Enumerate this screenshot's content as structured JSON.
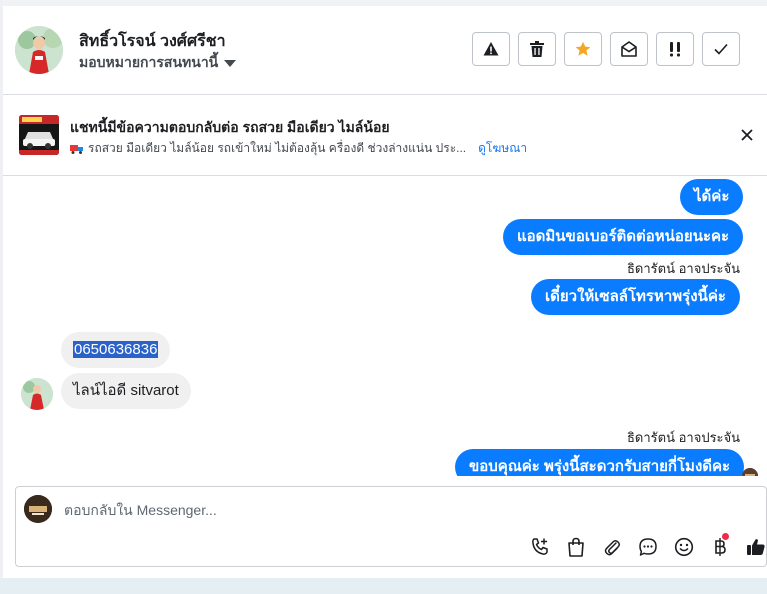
{
  "header": {
    "contact_name": "สิทธิ์วโรจน์ วงศ์ศรีชา",
    "assign_label": "มอบหมายการสนทนานี้",
    "actions": [
      {
        "name": "spam-button",
        "icon": "warning-triangle-icon"
      },
      {
        "name": "delete-button",
        "icon": "trash-icon"
      },
      {
        "name": "star-button",
        "icon": "star-icon"
      },
      {
        "name": "mark-unread-button",
        "icon": "open-envelope-icon"
      },
      {
        "name": "priority-button",
        "icon": "double-exclamation-icon"
      },
      {
        "name": "done-button",
        "icon": "checkmark-icon"
      }
    ]
  },
  "ad": {
    "title": "แชทนี้มีข้อความตอบกลับต่อ รถสวย มือเดียว ไมล์น้อย",
    "subtitle": "รถสวย มือเดียว ไมล์น้อย รถเข้าใหม่ ไม่ต้องลุ้น ครื่องดี ช่วงล่างแน่น ประ...",
    "link": "ดูโฆษณา"
  },
  "messages": {
    "m1": "ได้ค่ะ",
    "m2": "แอดมินขอเบอร์ติดต่อหน่อยนะคะ",
    "sender1": "ธิดารัตน์ อาจประจัน",
    "m3": "เดี๋ยวให้เซลล์โทรหาพรุ่งนี้ค่ะ",
    "m4": "0650636836",
    "m5": "ไลน์ไอดี sitvarot",
    "sender2": "ธิดารัตน์ อาจประจัน",
    "m6": "ขอบคุณค่ะ พรุ่งนี้สะดวกรับสายกี่โมงดีคะ"
  },
  "composer": {
    "placeholder": "ตอบกลับใน Messenger...",
    "tools": [
      "call-add-icon",
      "shopping-bag-icon",
      "paperclip-icon",
      "chat-bubble-icon",
      "emoji-icon",
      "baht-icon",
      "thumbs-up-icon"
    ]
  },
  "colors": {
    "accent": "#0a7cff",
    "star": "#f5a623",
    "notification": "#f02849"
  }
}
